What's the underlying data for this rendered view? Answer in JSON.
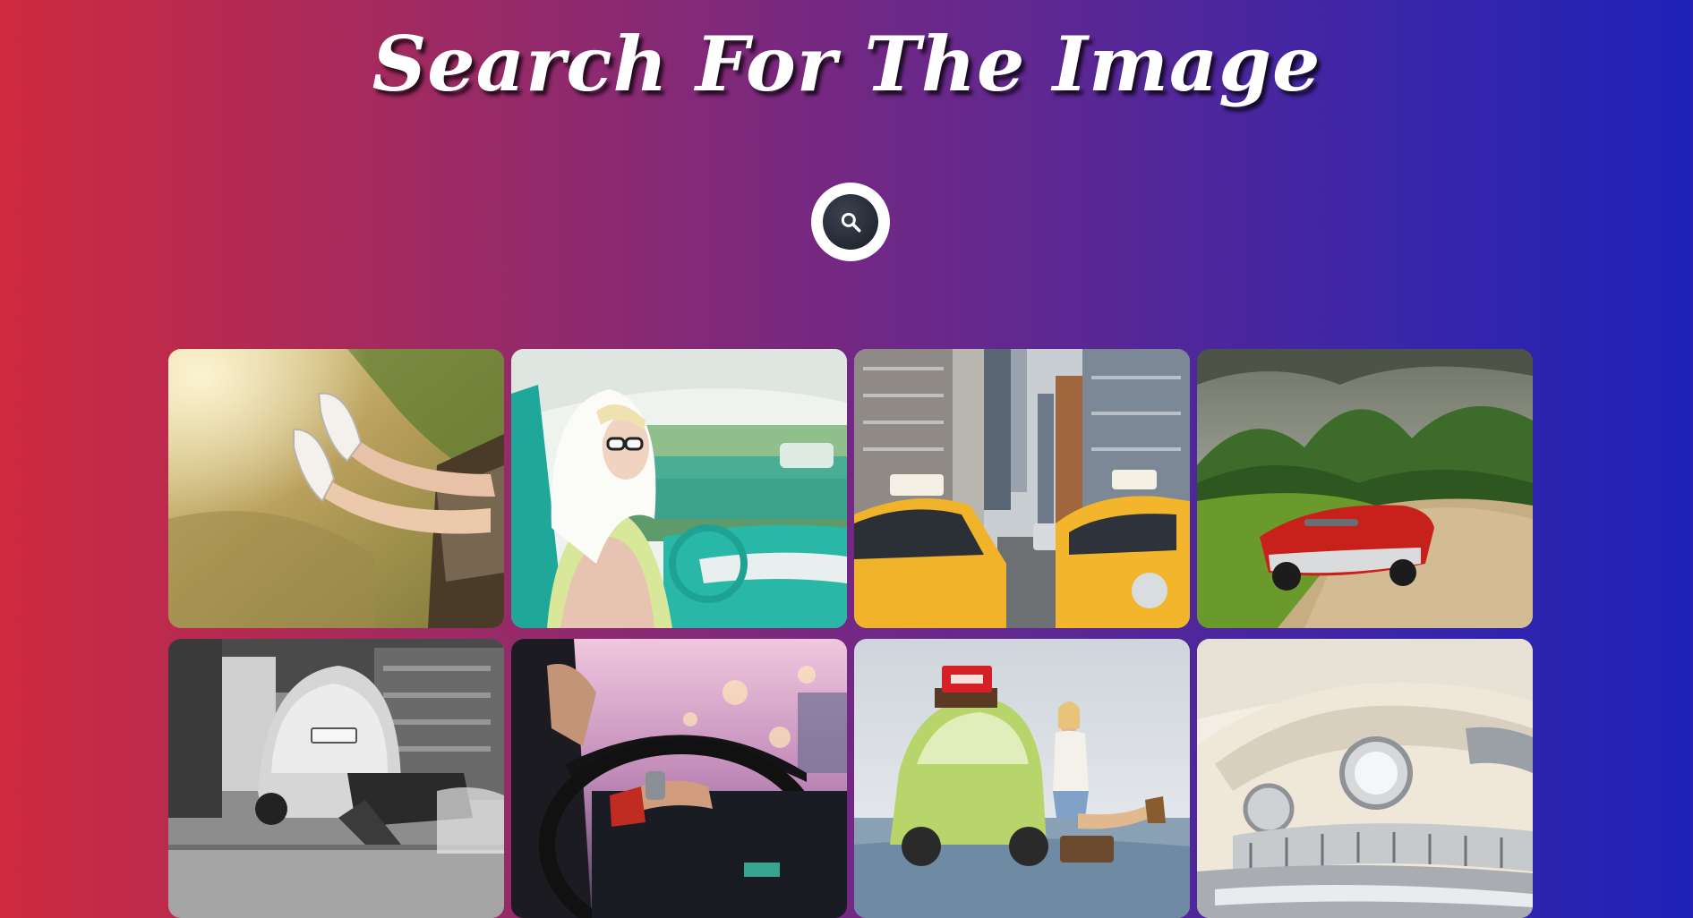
{
  "header": {
    "title": "Search For The Image"
  },
  "search": {
    "icon": "search-icon",
    "button_color": "#272c36"
  },
  "colors": {
    "gradient_start": "#cf2a3f",
    "gradient_end": "#1e22b8"
  },
  "gallery": {
    "images": [
      {
        "name": "sneakers-out-car-window"
      },
      {
        "name": "retro-woman-driving"
      },
      {
        "name": "city-yellow-taxis"
      },
      {
        "name": "red-convertible-dirt-road"
      },
      {
        "name": "bw-beetle-garage"
      },
      {
        "name": "hands-on-steering-wheel"
      },
      {
        "name": "woman-green-beetle-beach"
      },
      {
        "name": "vintage-cadillac-front"
      }
    ]
  }
}
